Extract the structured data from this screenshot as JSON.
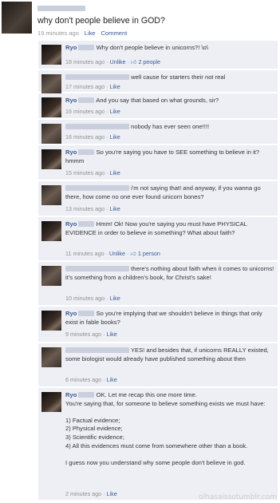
{
  "post": {
    "text": "why don't people believe in GOD?",
    "time": "19 minutes ago",
    "sep": "·",
    "like": "Like",
    "comment": "Comment"
  },
  "comments": [
    {
      "author": "Ryo",
      "text": "Why don't people believe in unicorns?! \\o\\",
      "time": "18 minutes ago",
      "action": "Unlike",
      "likes": "2 people"
    },
    {
      "author": "",
      "text": "well cause for starters their not real",
      "time": "17 minutes ago",
      "action": "Like"
    },
    {
      "author": "Ryo",
      "text": "And you say that based on what grounds, sir?",
      "time": "16 minutes ago",
      "action": "Like"
    },
    {
      "author": "",
      "text": "nobody has ever seen one!!!!",
      "time": "16 minutes ago",
      "action": "Like"
    },
    {
      "author": "Ryo",
      "text": "So you're saying you have to SEE something to believe in it? hmmm",
      "time": "15 minutes ago",
      "action": "Like"
    },
    {
      "author": "",
      "text": "i'm not saying that! and anyway, if you wanna go there, how come no one ever found unicorn bones?",
      "time": "13 minutes ago",
      "action": "Like"
    },
    {
      "author": "Ryo",
      "text": "Hmm! Ok! Now you're saying you must have PHYSICAL EVIDENCE in order to believe in something? What about faith?",
      "time": "11 minutes ago",
      "action": "Unlike",
      "likes": "1 person"
    },
    {
      "author": "",
      "text": "there's nothing about faith when it comes to unicorns! it's something from a children's book, for Christ's sake!",
      "time": "10 minutes ago",
      "action": "Like"
    },
    {
      "author": "Ryo",
      "text": "So you're implying that we shouldn't believe in things that only exist in fable books?",
      "time": "9 minutes ago",
      "action": "Like"
    },
    {
      "author": "",
      "text": "YES! and besides that, if unicorns REALLY existed, some biologist would already have published something about then",
      "time": "6 minutes ago",
      "action": "Like"
    },
    {
      "author": "Ryo",
      "text": "OK. Let me recap this one more time.",
      "lines": [
        "You're saying that, for someone to believe something exists we must have:",
        "",
        "1) Factual evidence;",
        "2) Physical evidence;",
        "3) Scientific evidence;",
        "4) All this evidences must come from somewhere other than a book.",
        "",
        "I guess now you understand why some people don't believe in god."
      ],
      "time": "2 minutes ago",
      "action": "Like"
    }
  ],
  "watermark": "olhasaissotumblr.com"
}
